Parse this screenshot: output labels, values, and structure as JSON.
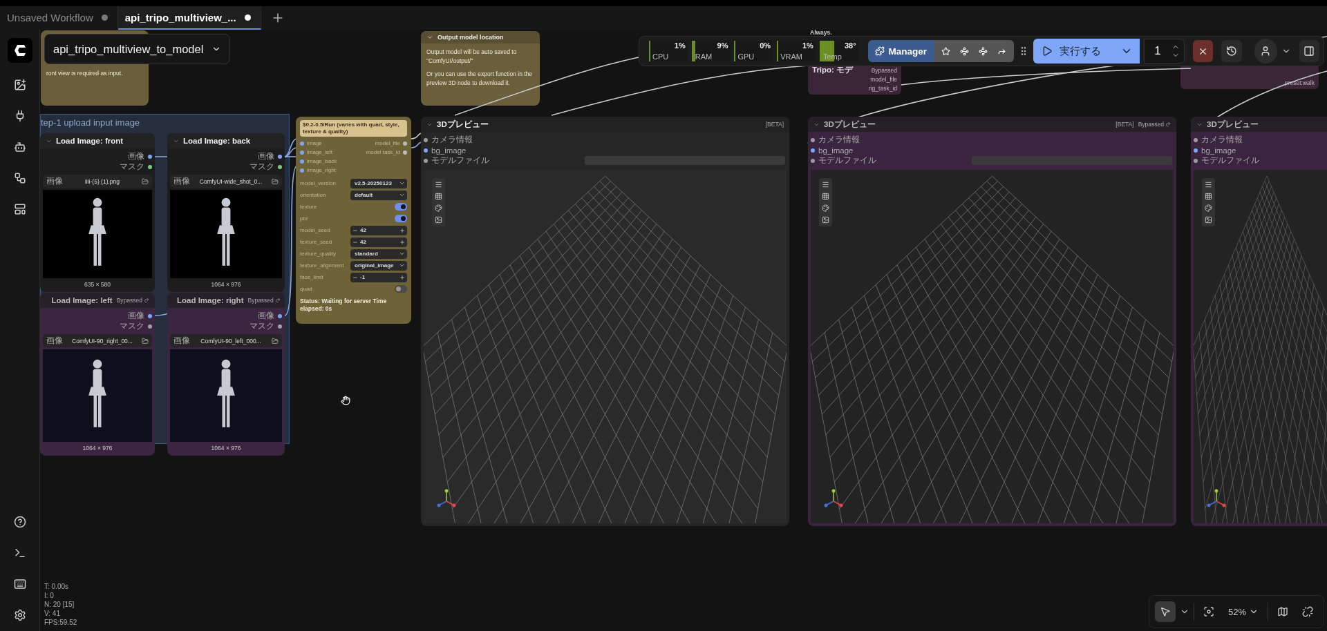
{
  "tabs": [
    {
      "label": "Unsaved Workflow",
      "selected": false,
      "modified": true
    },
    {
      "label": "api_tripo_multiview_...",
      "selected": true,
      "modified": true
    }
  ],
  "workflow_title": "api_tripo_multiview_to_model",
  "system_stats": [
    {
      "label": "CPU",
      "value": "1%",
      "level": 0.01
    },
    {
      "label": "RAM",
      "value": "9%",
      "level": 0.09
    },
    {
      "label": "GPU",
      "value": "0%",
      "level": 0
    },
    {
      "label": "VRAM",
      "value": "1%",
      "level": 0.01
    },
    {
      "label": "Temp",
      "value": "38°",
      "level": 0.38
    }
  ],
  "manager": {
    "label": "Manager"
  },
  "run": {
    "label": "実行する",
    "count": "1"
  },
  "notes": [
    {
      "lines": [
        "ront view is required as input."
      ]
    },
    {
      "title": "Output model location",
      "lines": [
        "Output model will be auto saved to \"ComfyUI/output/\"",
        "Or you can use the export function in the preview 3D node to download it."
      ]
    }
  ],
  "background_nodes": {
    "fragment": "Always.",
    "tripo_title": "Tripo: モデ",
    "tripo_badge": "Bypassed",
    "tripo_outputs": [
      "model_file",
      "rig_task_id"
    ],
    "animation_value": "preset:walk"
  },
  "group": {
    "title": "tep-1 upload input image"
  },
  "load_image_nodes": [
    {
      "title": "Load Image: front",
      "bypassed": false,
      "outputs": [
        {
          "label": "画像",
          "color": "#7ea6f5"
        },
        {
          "label": "マスク",
          "color": "#81c784"
        }
      ],
      "widget_label": "画像",
      "filename": "iiii-(5) (1).png",
      "size": "635 × 580"
    },
    {
      "title": "Load Image: back",
      "bypassed": false,
      "outputs": [
        {
          "label": "画像",
          "color": "#7ea6f5"
        },
        {
          "label": "マスク",
          "color": "#81c784"
        }
      ],
      "widget_label": "画像",
      "filename": "ComfyUI-wide_shot_0...",
      "size": "1064 × 976"
    },
    {
      "title": "Load Image: left",
      "bypassed": true,
      "badge": "Bypassed",
      "outputs": [
        {
          "label": "画像",
          "color": "#7ea6f5"
        },
        {
          "label": "マスク",
          "color": "#9e9e9e"
        }
      ],
      "widget_label": "画像",
      "filename": "ComfyUI-90_right_00...",
      "size": "1064 × 976"
    },
    {
      "title": "Load Image: right",
      "bypassed": true,
      "badge": "Bypassed",
      "outputs": [
        {
          "label": "画像",
          "color": "#7ea6f5"
        },
        {
          "label": "マスク",
          "color": "#9e9e9e"
        }
      ],
      "widget_label": "画像",
      "filename": "ComfyUI-90_left_000...",
      "size": "1064 × 976"
    }
  ],
  "tripo_node": {
    "price": "$0.2-0.5/Run (varies with quad, style, texture & quality)",
    "inputs": [
      "image",
      "image_left",
      "image_back",
      "image_right"
    ],
    "outputs": [
      "model_file",
      "model task_id"
    ],
    "widgets": [
      {
        "kind": "combo",
        "label": "model_version",
        "value": "v2.5-20250123"
      },
      {
        "kind": "combo",
        "label": "orientation",
        "value": "default"
      },
      {
        "kind": "toggle",
        "label": "texture",
        "on": true
      },
      {
        "kind": "toggle",
        "label": "pbr",
        "on": true
      },
      {
        "kind": "number",
        "label": "model_seed",
        "value": "42"
      },
      {
        "kind": "number",
        "label": "texture_seed",
        "value": "42"
      },
      {
        "kind": "combo",
        "label": "texture_quality",
        "value": "standard"
      },
      {
        "kind": "combo",
        "label": "texture_alignment",
        "value": "original_image"
      },
      {
        "kind": "number",
        "label": "face_limit",
        "value": "-1"
      },
      {
        "kind": "toggle",
        "label": "quad",
        "on": false
      }
    ],
    "status": "Status: Waiting for server Time elapsed: 0s"
  },
  "preview_nodes": [
    {
      "title": "3Dプレビュー",
      "badge": "[BETA]",
      "bypassed": false,
      "inputs": [
        {
          "label": "カメラ情報",
          "color": "#9e9e9e"
        },
        {
          "label": "bg_image",
          "color": "#7ea6f5"
        },
        {
          "label": "モデルファイル",
          "color": "#9e9e9e"
        }
      ]
    },
    {
      "title": "3Dプレビュー",
      "badge": "[BETA]",
      "bypassed": true,
      "bypass_label": "Bypassed",
      "inputs": [
        {
          "label": "カメラ情報",
          "color": "#9e9e9e"
        },
        {
          "label": "bg_image",
          "color": "#7ea6f5"
        },
        {
          "label": "モデルファイル",
          "color": "#9e9e9e"
        }
      ]
    },
    {
      "title": "3Dプレビュー",
      "bypassed": true,
      "inputs": [
        {
          "label": "カメラ情報",
          "color": "#9e9e9e"
        },
        {
          "label": "bg_image",
          "color": "#7ea6f5"
        },
        {
          "label": "モデルファイル",
          "color": "#9e9e9e"
        }
      ]
    }
  ],
  "render_stats": [
    "T: 0.00s",
    "I: 0",
    "N: 20 [15]",
    "V: 41",
    "FPS:59.52"
  ],
  "canvas_controls": {
    "pointer_selected": true,
    "zoom": "52%"
  }
}
